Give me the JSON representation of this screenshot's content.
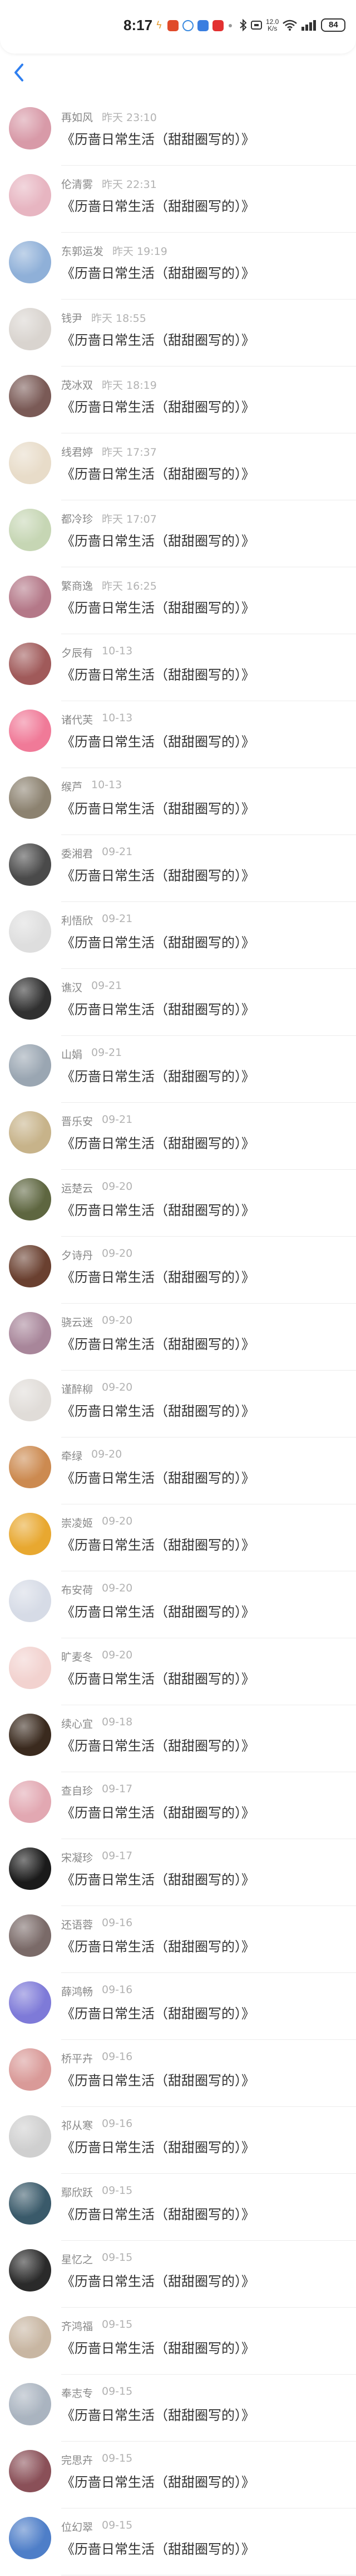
{
  "status_bar": {
    "time": "8:17",
    "network_speed_value": "12.0",
    "network_speed_unit": "K/s",
    "battery": "84",
    "icons": [
      "signal-icon",
      "wifi-icon",
      "bluetooth-icon",
      "dnd-icon"
    ]
  },
  "nav": {
    "back_icon": "chevron-left-icon"
  },
  "list": {
    "items": [
      {
        "name": "再如风",
        "time": "昨天 23:10",
        "message": "《历啬日常生活（甜甜圈写的）》",
        "avatar_color": "#d89aa8"
      },
      {
        "name": "伦清雾",
        "time": "昨天 22:31",
        "message": "《历啬日常生活（甜甜圈写的）》",
        "avatar_color": "#e7b5c1"
      },
      {
        "name": "东郭运发",
        "time": "昨天 19:19",
        "message": "《历啬日常生活（甜甜圈写的）》",
        "avatar_color": "#8fb0d8"
      },
      {
        "name": "钱尹",
        "time": "昨天 18:55",
        "message": "《历啬日常生活（甜甜圈写的）》",
        "avatar_color": "#d9d4cf"
      },
      {
        "name": "茂冰双",
        "time": "昨天 18:19",
        "message": "《历啬日常生活（甜甜圈写的）》",
        "avatar_color": "#7a5a56"
      },
      {
        "name": "线君婷",
        "time": "昨天 17:37",
        "message": "《历啬日常生活（甜甜圈写的）》",
        "avatar_color": "#e8dcc9"
      },
      {
        "name": "都冷珍",
        "time": "昨天 17:07",
        "message": "《历啬日常生活（甜甜圈写的）》",
        "avatar_color": "#c6d6b4"
      },
      {
        "name": "繁商逸",
        "time": "昨天 16:25",
        "message": "《历啬日常生活（甜甜圈写的）》",
        "avatar_color": "#b47888"
      },
      {
        "name": "夕辰有",
        "time": "10-13",
        "message": "《历啬日常生活（甜甜圈写的）》",
        "avatar_color": "#a05a5a"
      },
      {
        "name": "诸代芙",
        "time": "10-13",
        "message": "《历啬日常生活（甜甜圈写的）》",
        "avatar_color": "#f07a98"
      },
      {
        "name": "缑芦",
        "time": "10-13",
        "message": "《历啬日常生活（甜甜圈写的）》",
        "avatar_color": "#8c8270"
      },
      {
        "name": "委湘君",
        "time": "09-21",
        "message": "《历啬日常生活（甜甜圈写的）》",
        "avatar_color": "#4a4a4a"
      },
      {
        "name": "利悟欣",
        "time": "09-21",
        "message": "《历啬日常生活（甜甜圈写的）》",
        "avatar_color": "#dedede"
      },
      {
        "name": "谯汉",
        "time": "09-21",
        "message": "《历啬日常生活（甜甜圈写的）》",
        "avatar_color": "#303030"
      },
      {
        "name": "山娟",
        "time": "09-21",
        "message": "《历啬日常生活（甜甜圈写的）》",
        "avatar_color": "#9aa6b2"
      },
      {
        "name": "晋乐安",
        "time": "09-21",
        "message": "《历啬日常生活（甜甜圈写的）》",
        "avatar_color": "#c7b38a"
      },
      {
        "name": "运楚云",
        "time": "09-20",
        "message": "《历啬日常生活（甜甜圈写的）》",
        "avatar_color": "#5e6640"
      },
      {
        "name": "夕诗丹",
        "time": "09-20",
        "message": "《历啬日常生活（甜甜圈写的）》",
        "avatar_color": "#6a4030"
      },
      {
        "name": "骁云迷",
        "time": "09-20",
        "message": "《历啬日常生活（甜甜圈写的）》",
        "avatar_color": "#a8869a"
      },
      {
        "name": "谨醉柳",
        "time": "09-20",
        "message": "《历啬日常生活（甜甜圈写的）》",
        "avatar_color": "#e0dcd8"
      },
      {
        "name": "牵绿",
        "time": "09-20",
        "message": "《历啬日常生活（甜甜圈写的）》",
        "avatar_color": "#cc8a50"
      },
      {
        "name": "崇凌姬",
        "time": "09-20",
        "message": "《历啬日常生活（甜甜圈写的）》",
        "avatar_color": "#e8a830"
      },
      {
        "name": "布安荷",
        "time": "09-20",
        "message": "《历啬日常生活（甜甜圈写的）》",
        "avatar_color": "#d6dbe6"
      },
      {
        "name": "旷麦冬",
        "time": "09-20",
        "message": "《历啬日常生活（甜甜圈写的）》",
        "avatar_color": "#f2d2cf"
      },
      {
        "name": "续心宜",
        "time": "09-18",
        "message": "《历啬日常生活（甜甜圈写的）》",
        "avatar_color": "#3a2a1e"
      },
      {
        "name": "查自珍",
        "time": "09-17",
        "message": "《历啬日常生活（甜甜圈写的）》",
        "avatar_color": "#e2a8b2"
      },
      {
        "name": "宋凝珍",
        "time": "09-17",
        "message": "《历啬日常生活（甜甜圈写的）》",
        "avatar_color": "#1a1a1a"
      },
      {
        "name": "还语蓉",
        "time": "09-16",
        "message": "《历啬日常生活（甜甜圈写的）》",
        "avatar_color": "#7a6a68"
      },
      {
        "name": "薛鸿畅",
        "time": "09-16",
        "message": "《历啬日常生活（甜甜圈写的）》",
        "avatar_color": "#7e7ad8"
      },
      {
        "name": "桥平卉",
        "time": "09-16",
        "message": "《历啬日常生活（甜甜圈写的）》",
        "avatar_color": "#d99a98"
      },
      {
        "name": "祁从寒",
        "time": "09-16",
        "message": "《历啬日常生活（甜甜圈写的）》",
        "avatar_color": "#cfcfcf"
      },
      {
        "name": "鄢欣跃",
        "time": "09-15",
        "message": "《历啬日常生活（甜甜圈写的）》",
        "avatar_color": "#3a5a6a"
      },
      {
        "name": "星忆之",
        "time": "09-15",
        "message": "《历啬日常生活（甜甜圈写的）》",
        "avatar_color": "#2a2a2a"
      },
      {
        "name": "齐鸿福",
        "time": "09-15",
        "message": "《历啬日常生活（甜甜圈写的）》",
        "avatar_color": "#c8b6a2"
      },
      {
        "name": "奉志专",
        "time": "09-15",
        "message": "《历啬日常生活（甜甜圈写的）》",
        "avatar_color": "#aab4c0"
      },
      {
        "name": "完思卉",
        "time": "09-15",
        "message": "《历啬日常生活（甜甜圈写的）》",
        "avatar_color": "#8a5058"
      },
      {
        "name": "位幻翠",
        "time": "09-15",
        "message": "《历啬日常生活（甜甜圈写的）》",
        "avatar_color": "#4e7ec8"
      }
    ]
  }
}
